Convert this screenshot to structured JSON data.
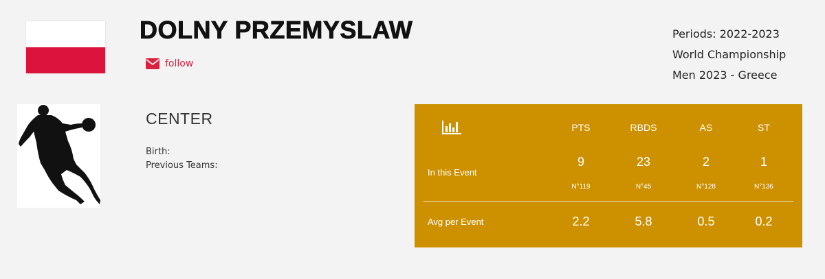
{
  "player": {
    "name": "DOLNY PRZEMYSLAW",
    "follow_label": "follow",
    "position": "CENTER",
    "birth_label": "Birth:",
    "previous_teams_label": "Previous Teams:"
  },
  "flag": {
    "colors": [
      "#ffffff",
      "#dc143c"
    ]
  },
  "event": {
    "periods": "Periods: 2022-2023",
    "competition": "World Championship",
    "edition": "Men 2023 - Greece"
  },
  "stats": {
    "columns": [
      "PTS",
      "RBDS",
      "AS",
      "ST"
    ],
    "rows": [
      {
        "label": "In this Event",
        "values": [
          "9",
          "23",
          "2",
          "1"
        ],
        "ranks": [
          "N°119",
          "N°45",
          "N°128",
          "N°136"
        ]
      },
      {
        "label": "Avg per Event",
        "values": [
          "2.2",
          "5.8",
          "0.5",
          "0.2"
        ]
      }
    ],
    "icon": "bar-chart-icon",
    "background_color": "#cd9100"
  },
  "colors": {
    "accent": "#d9223f",
    "page_background": "#f3f3f3"
  }
}
